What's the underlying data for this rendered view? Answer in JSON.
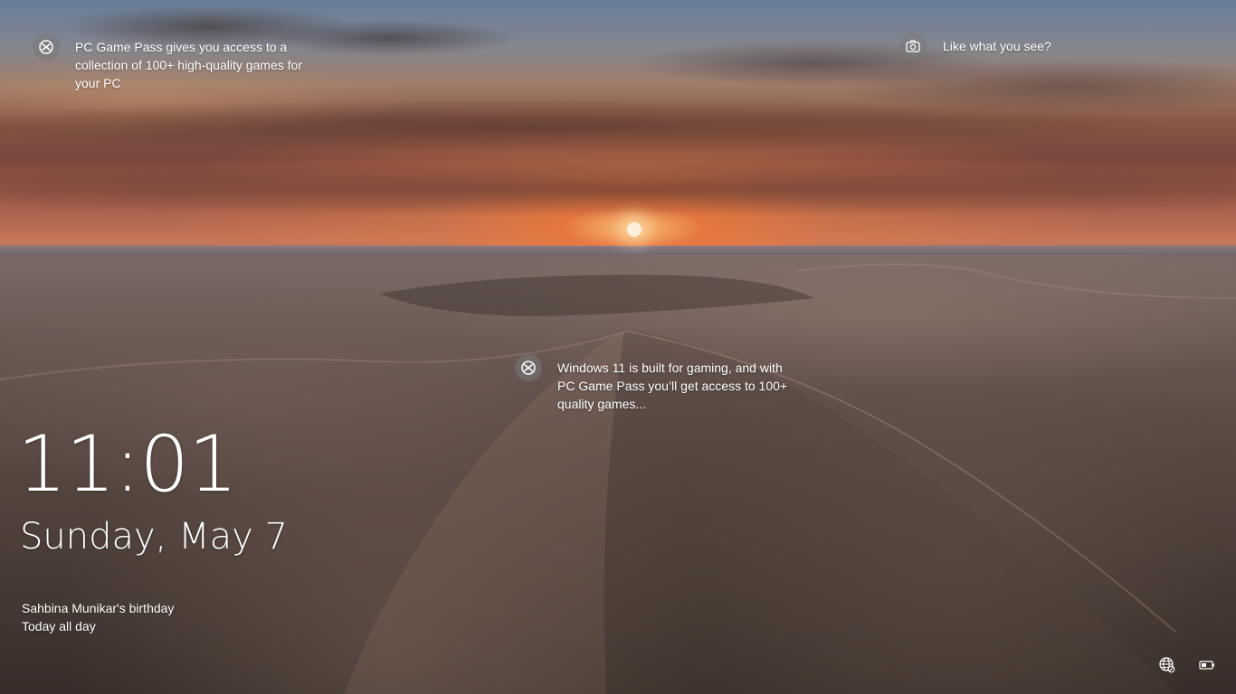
{
  "spotlight": {
    "left_hotspot": {
      "icon": "xbox-icon",
      "text": "PC Game Pass gives you access to a\ncollection of 100+ high-quality games for\nyour PC"
    },
    "middle_hotspot": {
      "icon": "xbox-icon",
      "text": "Windows 11 is built for gaming, and with\nPC Game Pass you’ll get access to 100+\nquality games..."
    },
    "feedback": {
      "icon": "camera-icon",
      "text": "Like what you see?"
    }
  },
  "clock": {
    "time": "11:01",
    "date": "Sunday, May 7"
  },
  "event": {
    "title": "Sahbina Munikar's birthday",
    "when": "Today all day"
  },
  "status": {
    "network_icon": "globe-network-icon",
    "battery_icon": "battery-icon"
  }
}
